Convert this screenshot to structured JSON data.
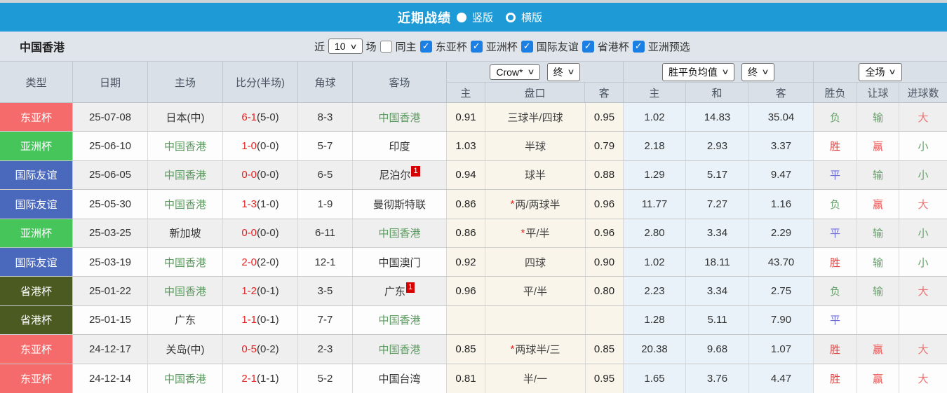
{
  "colors": {
    "topbar": "#1e9bd7",
    "checkbox_checked": "#1b7fe4",
    "header_bg": "#d9e0e7",
    "odds_group_bg": "#faf5eb",
    "mean_group_bg": "#e9f2f8",
    "row_stripe": "#efefef",
    "type_east_asia": "#f56b6b",
    "type_asian_cup": "#45c55a",
    "type_friendly": "#4a69bd",
    "type_province_hk": "#4a5a20"
  },
  "title_bar": {
    "title": "近期战绩",
    "option_vertical": "竖版",
    "option_horizontal": "横版",
    "selected_option": "竖版"
  },
  "filter": {
    "team": "中国香港",
    "near_label": "近",
    "count": "10",
    "games_label": "场",
    "checks": [
      {
        "label": "同主",
        "mark": ""
      },
      {
        "label": "东亚杯",
        "mark": "✓"
      },
      {
        "label": "亚洲杯",
        "mark": "✓"
      },
      {
        "label": "国际友谊",
        "mark": "✓"
      },
      {
        "label": "省港杯",
        "mark": "✓"
      },
      {
        "label": "亚洲预选",
        "mark": "✓"
      }
    ]
  },
  "table": {
    "head": {
      "type": "类型",
      "date": "日期",
      "home": "主场",
      "score": "比分(半场)",
      "corner": "角球",
      "away": "客场",
      "odds_home": "主",
      "handicap": "盘口",
      "odds_away": "客",
      "mean_home": "主",
      "mean_draw": "和",
      "mean_away": "客",
      "result": "胜负",
      "handicap_result": "让球",
      "goals": "进球数"
    },
    "selects": {
      "company": "Crow*",
      "company_period": "终",
      "mean": "胜平负均值",
      "mean_period": "终",
      "scope": "全场"
    },
    "rows": [
      {
        "type": "东亚杯",
        "type_bg": "#f56b6b",
        "date": "25-07-08",
        "home": "日本(中)",
        "home_color": "#333333",
        "score_ft": "6-1",
        "score_ht": "(5-0)",
        "corner": "8-3",
        "away": "中国香港",
        "away_color": "#5a9b5e",
        "away_sup": "",
        "o_home": "0.91",
        "hc_star": "",
        "handicap": "三球半/四球",
        "o_away": "0.95",
        "m_home": "1.02",
        "m_draw": "14.83",
        "m_away": "35.04",
        "res": "负",
        "res_color": "#67a06a",
        "hr": "输",
        "hr_color": "#67a06a",
        "goal": "大",
        "goal_color": "#f17070"
      },
      {
        "type": "亚洲杯",
        "type_bg": "#45c55a",
        "date": "25-06-10",
        "home": "中国香港",
        "home_color": "#5a9b5e",
        "score_ft": "1-0",
        "score_ht": "(0-0)",
        "corner": "5-7",
        "away": "印度",
        "away_color": "#333333",
        "away_sup": "",
        "o_home": "1.03",
        "hc_star": "",
        "handicap": "半球",
        "o_away": "0.79",
        "m_home": "2.18",
        "m_draw": "2.93",
        "m_away": "3.37",
        "res": "胜",
        "res_color": "#e04545",
        "hr": "赢",
        "hr_color": "#ef5555",
        "goal": "小",
        "goal_color": "#67a06a"
      },
      {
        "type": "国际友谊",
        "type_bg": "#4a69bd",
        "date": "25-06-05",
        "home": "中国香港",
        "home_color": "#5a9b5e",
        "score_ft": "0-0",
        "score_ht": "(0-0)",
        "corner": "6-5",
        "away": "尼泊尔",
        "away_color": "#333333",
        "away_sup": "1",
        "o_home": "0.94",
        "hc_star": "",
        "handicap": "球半",
        "o_away": "0.88",
        "m_home": "1.29",
        "m_draw": "5.17",
        "m_away": "9.47",
        "res": "平",
        "res_color": "#6c6cd9",
        "hr": "输",
        "hr_color": "#67a06a",
        "goal": "小",
        "goal_color": "#67a06a"
      },
      {
        "type": "国际友谊",
        "type_bg": "#4a69bd",
        "date": "25-05-30",
        "home": "中国香港",
        "home_color": "#5a9b5e",
        "score_ft": "1-3",
        "score_ht": "(1-0)",
        "corner": "1-9",
        "away": "曼彻斯特联",
        "away_color": "#333333",
        "away_sup": "",
        "o_home": "0.86",
        "hc_star": "*",
        "handicap": "两/两球半",
        "o_away": "0.96",
        "m_home": "11.77",
        "m_draw": "7.27",
        "m_away": "1.16",
        "res": "负",
        "res_color": "#67a06a",
        "hr": "赢",
        "hr_color": "#ef5555",
        "goal": "大",
        "goal_color": "#f17070"
      },
      {
        "type": "亚洲杯",
        "type_bg": "#45c55a",
        "date": "25-03-25",
        "home": "新加坡",
        "home_color": "#333333",
        "score_ft": "0-0",
        "score_ht": "(0-0)",
        "corner": "6-11",
        "away": "中国香港",
        "away_color": "#5a9b5e",
        "away_sup": "",
        "o_home": "0.86",
        "hc_star": "*",
        "handicap": "平/半",
        "o_away": "0.96",
        "m_home": "2.80",
        "m_draw": "3.34",
        "m_away": "2.29",
        "res": "平",
        "res_color": "#6c6cd9",
        "hr": "输",
        "hr_color": "#67a06a",
        "goal": "小",
        "goal_color": "#67a06a"
      },
      {
        "type": "国际友谊",
        "type_bg": "#4a69bd",
        "date": "25-03-19",
        "home": "中国香港",
        "home_color": "#5a9b5e",
        "score_ft": "2-0",
        "score_ht": "(2-0)",
        "corner": "12-1",
        "away": "中国澳门",
        "away_color": "#333333",
        "away_sup": "",
        "o_home": "0.92",
        "hc_star": "",
        "handicap": "四球",
        "o_away": "0.90",
        "m_home": "1.02",
        "m_draw": "18.11",
        "m_away": "43.70",
        "res": "胜",
        "res_color": "#e04545",
        "hr": "输",
        "hr_color": "#67a06a",
        "goal": "小",
        "goal_color": "#67a06a"
      },
      {
        "type": "省港杯",
        "type_bg": "#4a5a20",
        "date": "25-01-22",
        "home": "中国香港",
        "home_color": "#5a9b5e",
        "score_ft": "1-2",
        "score_ht": "(0-1)",
        "corner": "3-5",
        "away": "广东",
        "away_color": "#333333",
        "away_sup": "1",
        "o_home": "0.96",
        "hc_star": "",
        "handicap": "平/半",
        "o_away": "0.80",
        "m_home": "2.23",
        "m_draw": "3.34",
        "m_away": "2.75",
        "res": "负",
        "res_color": "#67a06a",
        "hr": "输",
        "hr_color": "#67a06a",
        "goal": "大",
        "goal_color": "#f17070"
      },
      {
        "type": "省港杯",
        "type_bg": "#4a5a20",
        "date": "25-01-15",
        "home": "广东",
        "home_color": "#333333",
        "score_ft": "1-1",
        "score_ht": "(0-1)",
        "corner": "7-7",
        "away": "中国香港",
        "away_color": "#5a9b5e",
        "away_sup": "",
        "o_home": "",
        "hc_star": "",
        "handicap": "",
        "o_away": "",
        "m_home": "1.28",
        "m_draw": "5.11",
        "m_away": "7.90",
        "res": "平",
        "res_color": "#6c6cd9",
        "hr": "",
        "hr_color": "#67a06a",
        "goal": "",
        "goal_color": "#67a06a"
      },
      {
        "type": "东亚杯",
        "type_bg": "#f56b6b",
        "date": "24-12-17",
        "home": "关岛(中)",
        "home_color": "#333333",
        "score_ft": "0-5",
        "score_ht": "(0-2)",
        "corner": "2-3",
        "away": "中国香港",
        "away_color": "#5a9b5e",
        "away_sup": "",
        "o_home": "0.85",
        "hc_star": "*",
        "handicap": "两球半/三",
        "o_away": "0.85",
        "m_home": "20.38",
        "m_draw": "9.68",
        "m_away": "1.07",
        "res": "胜",
        "res_color": "#e04545",
        "hr": "赢",
        "hr_color": "#ef5555",
        "goal": "大",
        "goal_color": "#f17070"
      },
      {
        "type": "东亚杯",
        "type_bg": "#f56b6b",
        "date": "24-12-14",
        "home": "中国香港",
        "home_color": "#5a9b5e",
        "score_ft": "2-1",
        "score_ht": "(1-1)",
        "corner": "5-2",
        "away": "中国台湾",
        "away_color": "#333333",
        "away_sup": "",
        "o_home": "0.81",
        "hc_star": "",
        "handicap": "半/一",
        "o_away": "0.95",
        "m_home": "1.65",
        "m_draw": "3.76",
        "m_away": "4.47",
        "res": "胜",
        "res_color": "#e04545",
        "hr": "赢",
        "hr_color": "#ef5555",
        "goal": "大",
        "goal_color": "#f17070"
      }
    ]
  }
}
